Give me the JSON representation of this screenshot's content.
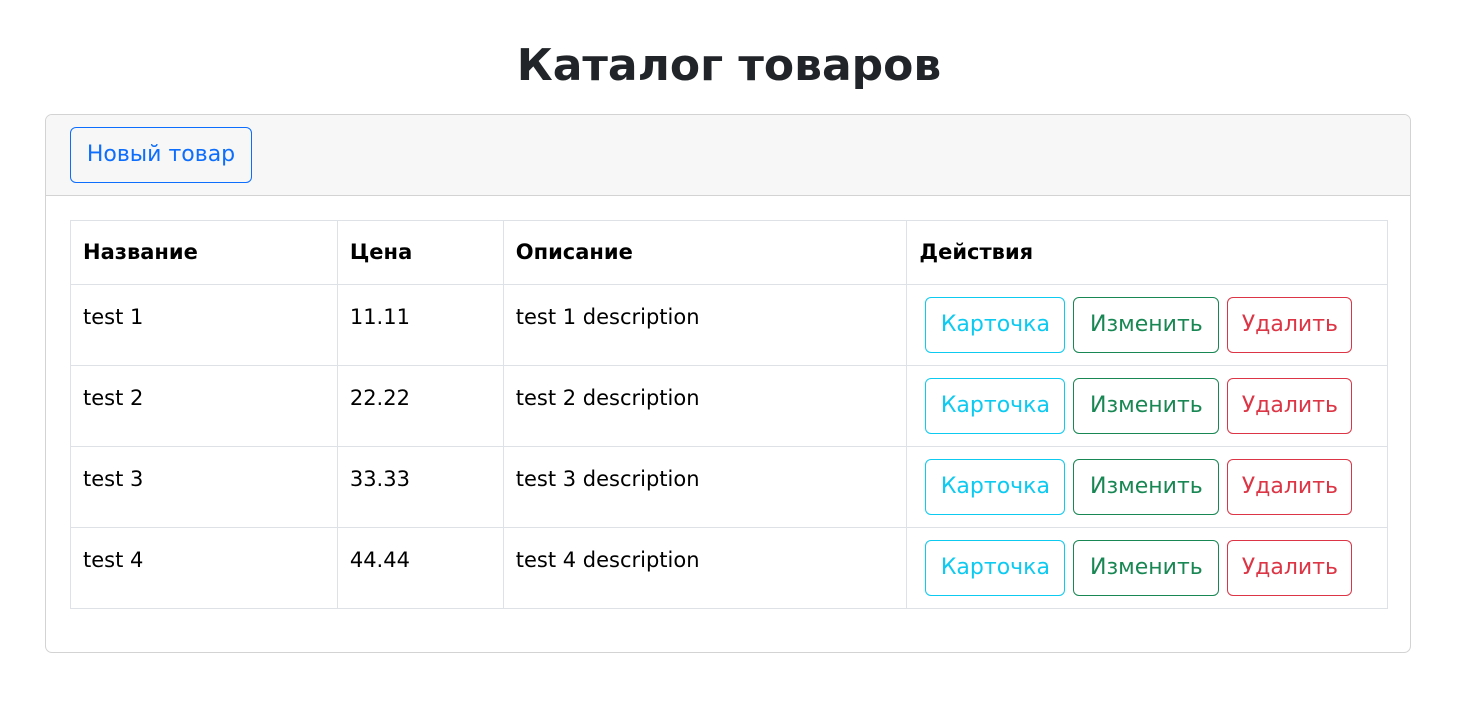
{
  "page": {
    "title": "Каталог товаров"
  },
  "toolbar": {
    "new_label": "Новый товар"
  },
  "table": {
    "headers": [
      "Название",
      "Цена",
      "Описание",
      "Действия"
    ],
    "rows": [
      {
        "name": "test 1",
        "price": "11.11",
        "description": "test 1 description"
      },
      {
        "name": "test 2",
        "price": "22.22",
        "description": "test 2 description"
      },
      {
        "name": "test 3",
        "price": "33.33",
        "description": "test 3 description"
      },
      {
        "name": "test 4",
        "price": "44.44",
        "description": "test 4 description"
      }
    ]
  },
  "actions": {
    "card_label": "Карточка",
    "edit_label": "Изменить",
    "delete_label": "Удалить"
  },
  "colors": {
    "primary": "#0d6efd",
    "info": "#0dcaf0",
    "success": "#198754",
    "danger": "#dc3545"
  }
}
